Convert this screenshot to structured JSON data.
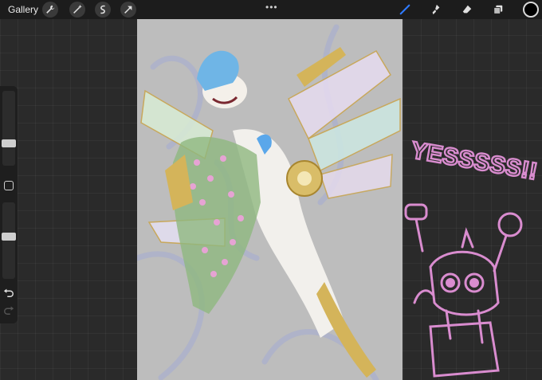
{
  "topbar": {
    "gallery_label": "Gallery",
    "left_tools": [
      "wrench-icon",
      "magic-wand-icon",
      "selection-icon",
      "transform-arrow-icon"
    ],
    "more_dots": "•••",
    "right_tools": [
      "brush-icon",
      "smudge-icon",
      "eraser-icon",
      "layers-icon"
    ],
    "active_tool": "brush-icon",
    "current_color": "#000000"
  },
  "sidebar": {
    "controls": [
      "brush-size-slider",
      "modify-button",
      "opacity-slider",
      "undo-icon",
      "redo-icon"
    ]
  },
  "overlay_text": {
    "exclaim": "YESSSSS!!"
  },
  "colors": {
    "accent": "#2f7bff",
    "doodle": "#d98ccf"
  }
}
